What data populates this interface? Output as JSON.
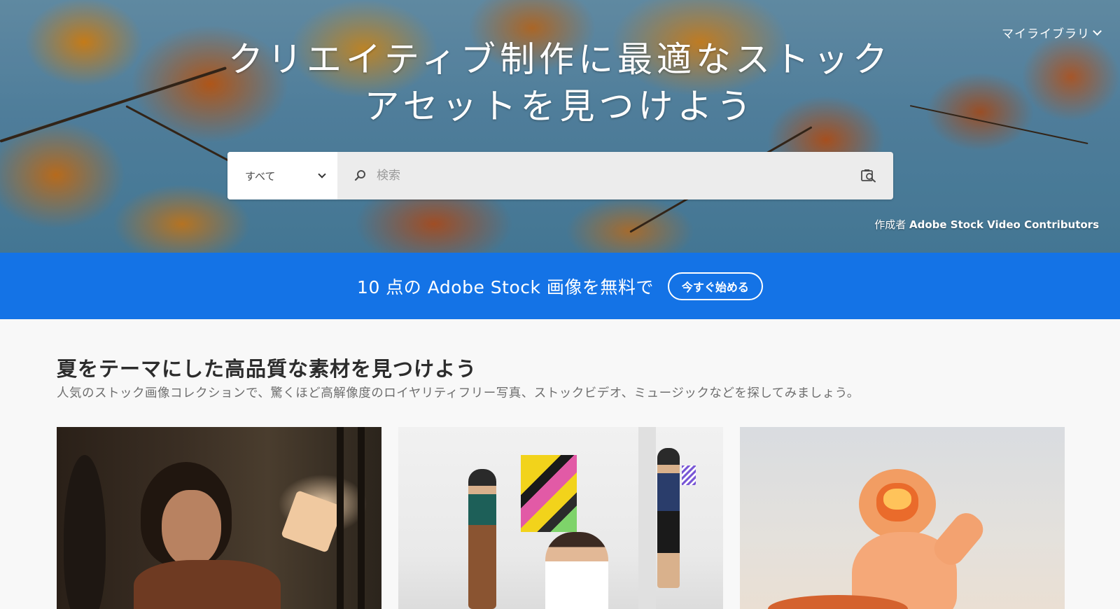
{
  "header": {
    "my_library_label": "マイライブラリ",
    "hero_title_line1": "クリエイティブ制作に最適なストック",
    "hero_title_line2": "アセットを見つけよう"
  },
  "search": {
    "type_selected": "すべて",
    "placeholder": "検索",
    "search_icon": "search-icon",
    "visual_search_icon": "visual-search-icon"
  },
  "credit": {
    "prefix": "作成者",
    "name": "Adobe Stock Video Contributors"
  },
  "promo": {
    "text": "10 点の Adobe Stock 画像を無料で",
    "cta_label": "今すぐ始める",
    "background": "#1473e6"
  },
  "section": {
    "title": "夏をテーマにした高品質な素材を見つけよう",
    "subtitle": "人気のストック画像コレクションで、驚くほど高解像度のロイヤリティフリー写真、ストックビデオ、ミュージックなどを探してみましょう。"
  }
}
